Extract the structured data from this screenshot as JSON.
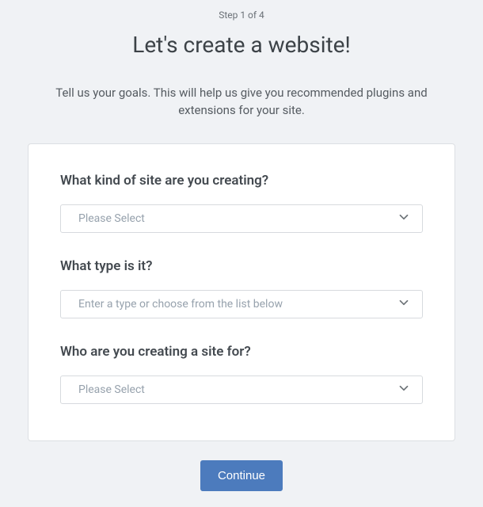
{
  "step": "Step 1 of 4",
  "title": "Let's create a website!",
  "subtitle": "Tell us your goals. This will help us give you recommended plugins and extensions for your site.",
  "form": {
    "siteKind": {
      "label": "What kind of site are you creating?",
      "placeholder": "Please Select"
    },
    "siteType": {
      "label": "What type is it?",
      "placeholder": "Enter a type or choose from the list below"
    },
    "siteFor": {
      "label": "Who are you creating a site for?",
      "placeholder": "Please Select"
    }
  },
  "continueLabel": "Continue"
}
